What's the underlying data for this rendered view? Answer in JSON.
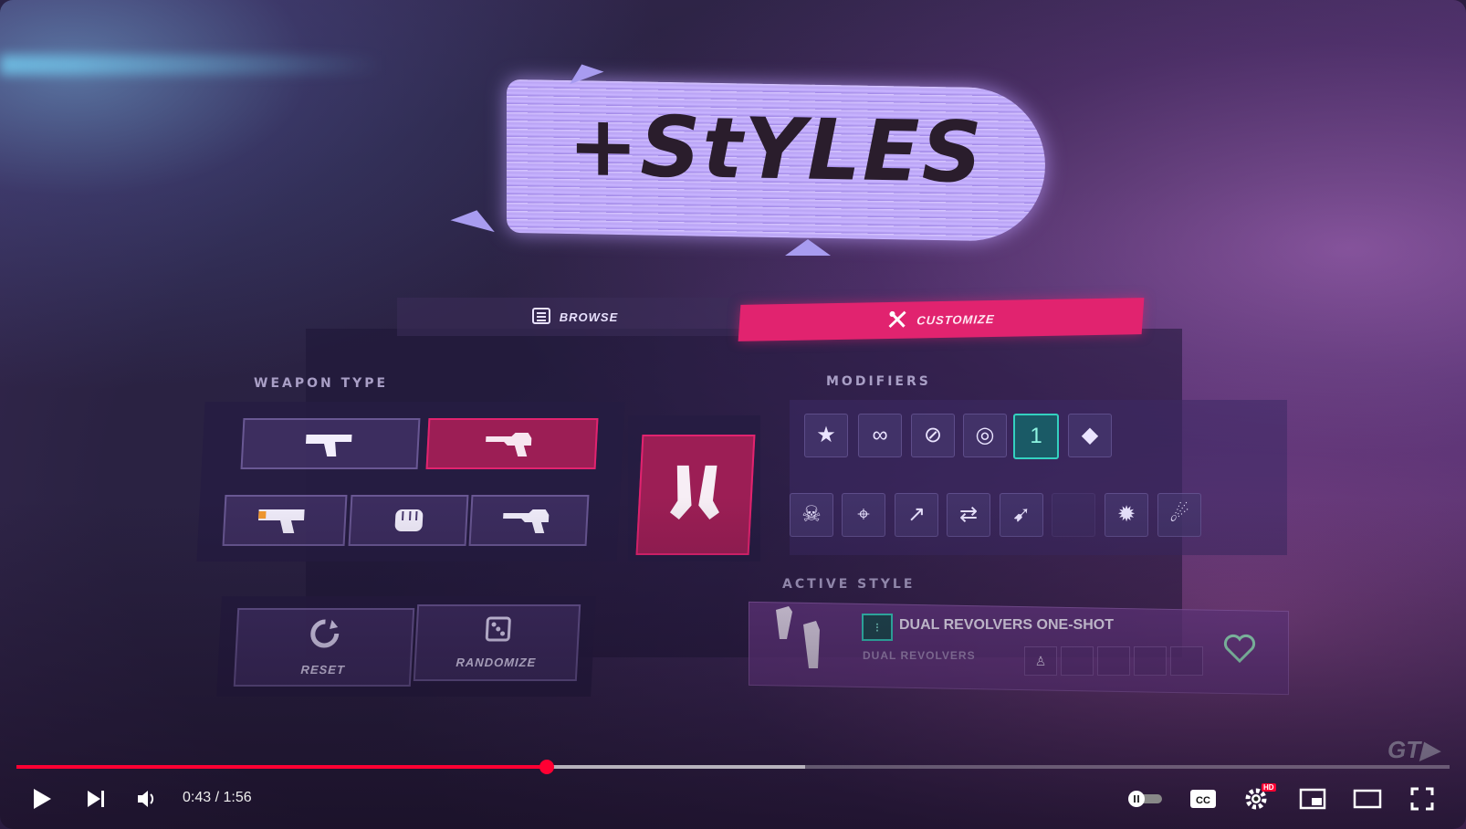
{
  "title": "+StYLES",
  "tabs": {
    "browse_label": "BROWSE",
    "customize_label": "CUSTOMIZE",
    "active_tab": "CUSTOMIZE"
  },
  "weapon_type": {
    "label": "WEAPON TYPE",
    "options": [
      "pistol-icon",
      "revolver-icon",
      "blaster-icon",
      "fist-icon",
      "revolver-icon"
    ],
    "selected_index": 1,
    "preview_icon": "dual-pistols-icon"
  },
  "modifiers": {
    "label": "MODIFIERS",
    "icons": [
      "badge-star-icon",
      "infinity-icon",
      "no-ammo-icon",
      "target-icon",
      "one-shot-icon",
      "gem-icon",
      "skull-icon",
      "crosshair-icon",
      "ricochet-icon",
      "swap-icon",
      "ghost-bullet-icon",
      "empty",
      "explosive-icon",
      "fire-bullets-icon"
    ],
    "active_index": 4
  },
  "active_style": {
    "label": "ACTIVE STYLE",
    "name": "DUAL REVOLVERS ONE-SHOT",
    "weapon": "DUAL REVOLVERS",
    "favorite_icon": "heart-icon"
  },
  "actions": {
    "reset_label": "RESET",
    "randomize_label": "RANDOMIZE"
  },
  "watermark": "GT▶",
  "player": {
    "current_time": "0:43",
    "duration": "1:56",
    "time_display": "0:43 / 1:56",
    "played_fraction": 0.37,
    "buffered_fraction": 0.55,
    "hd_badge": "HD",
    "accent_color": "#ff0033"
  },
  "colors": {
    "customize_tab": "#e1236f",
    "selected_weapon": "#9c1e55",
    "active_modifier": "#34d1c0"
  }
}
